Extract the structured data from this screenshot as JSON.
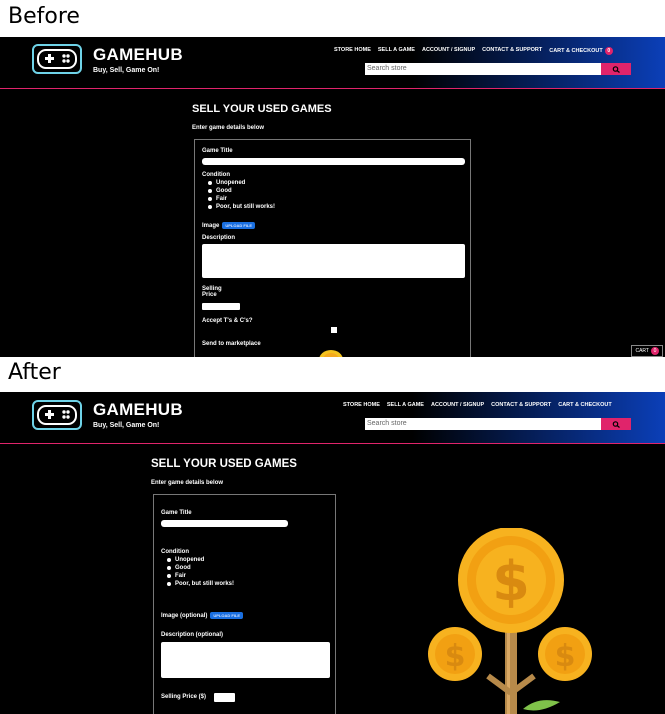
{
  "captions": {
    "before": "Before",
    "after": "After"
  },
  "brand": {
    "name": "GAMEHUB",
    "tagline": "Buy, Sell, Game On!"
  },
  "nav": [
    "STORE HOME",
    "SELL A GAME",
    "ACCOUNT / SIGNUP",
    "CONTACT & SUPPORT",
    "CART & CHECKOUT"
  ],
  "cart_count": "0",
  "search": {
    "placeholder": "Search store"
  },
  "before": {
    "title": "SELL YOUR USED GAMES",
    "subtitle": "Enter game details below",
    "game_title": "Game Title",
    "condition": "Condition",
    "options": [
      "Unopened",
      "Good",
      "Fair",
      "Poor, but still works!"
    ],
    "image": "Image",
    "upload": "UPLOAD FILE",
    "description": "Description",
    "price_line1": "Selling",
    "price_line2": "Price",
    "terms": "Accept T's & C's?",
    "send": "Send to marketplace",
    "cart_float": "CART"
  },
  "after": {
    "title": "SELL YOUR USED GAMES",
    "subtitle": "Enter game details below",
    "game_title": "Game Title",
    "condition": "Condition",
    "options": [
      "Unopened",
      "Good",
      "Fair",
      "Poor, but still works!"
    ],
    "image": "Image (optional)",
    "upload": "UPLOAD FILE",
    "description": "Description (optional)",
    "price": "Selling Price ($)"
  },
  "colors": {
    "accent": "#e0246b",
    "upload": "#1a6fe0",
    "coin": "#f4a81d",
    "header_blue": "#0b3fb8"
  }
}
